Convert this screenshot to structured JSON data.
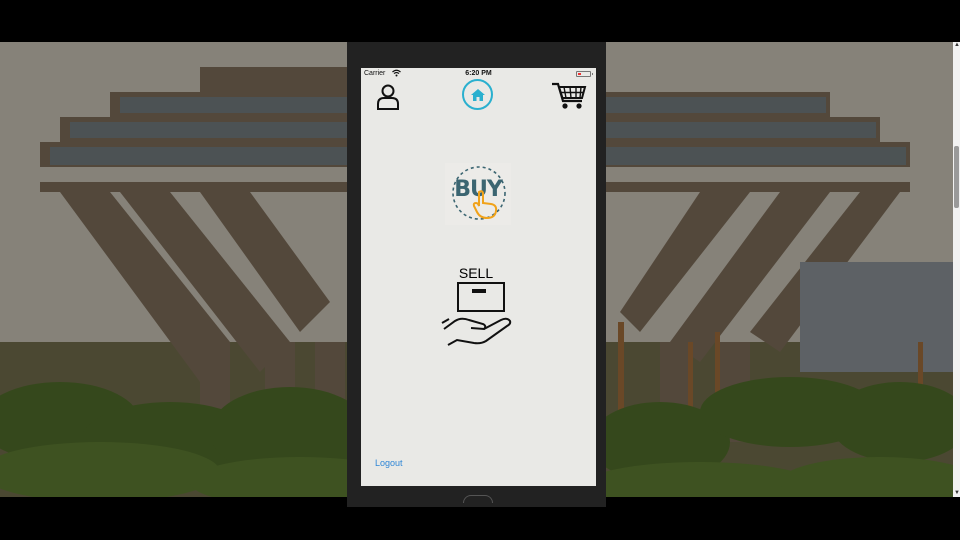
{
  "status_bar": {
    "carrier": "Carrier",
    "time": "6:20 PM"
  },
  "nav": {
    "profile_icon": "person-icon",
    "home_icon": "home-icon",
    "cart_icon": "shopping-cart-icon"
  },
  "main": {
    "buy_label": "BUY",
    "sell_label": "SELL"
  },
  "footer": {
    "logout_label": "Logout"
  },
  "colors": {
    "accent": "#2ab0cf",
    "link": "#2f86d6",
    "buy_text": "#3b6571",
    "buy_hand": "#f0a21a",
    "screen_bg": "#e9e9e6"
  }
}
